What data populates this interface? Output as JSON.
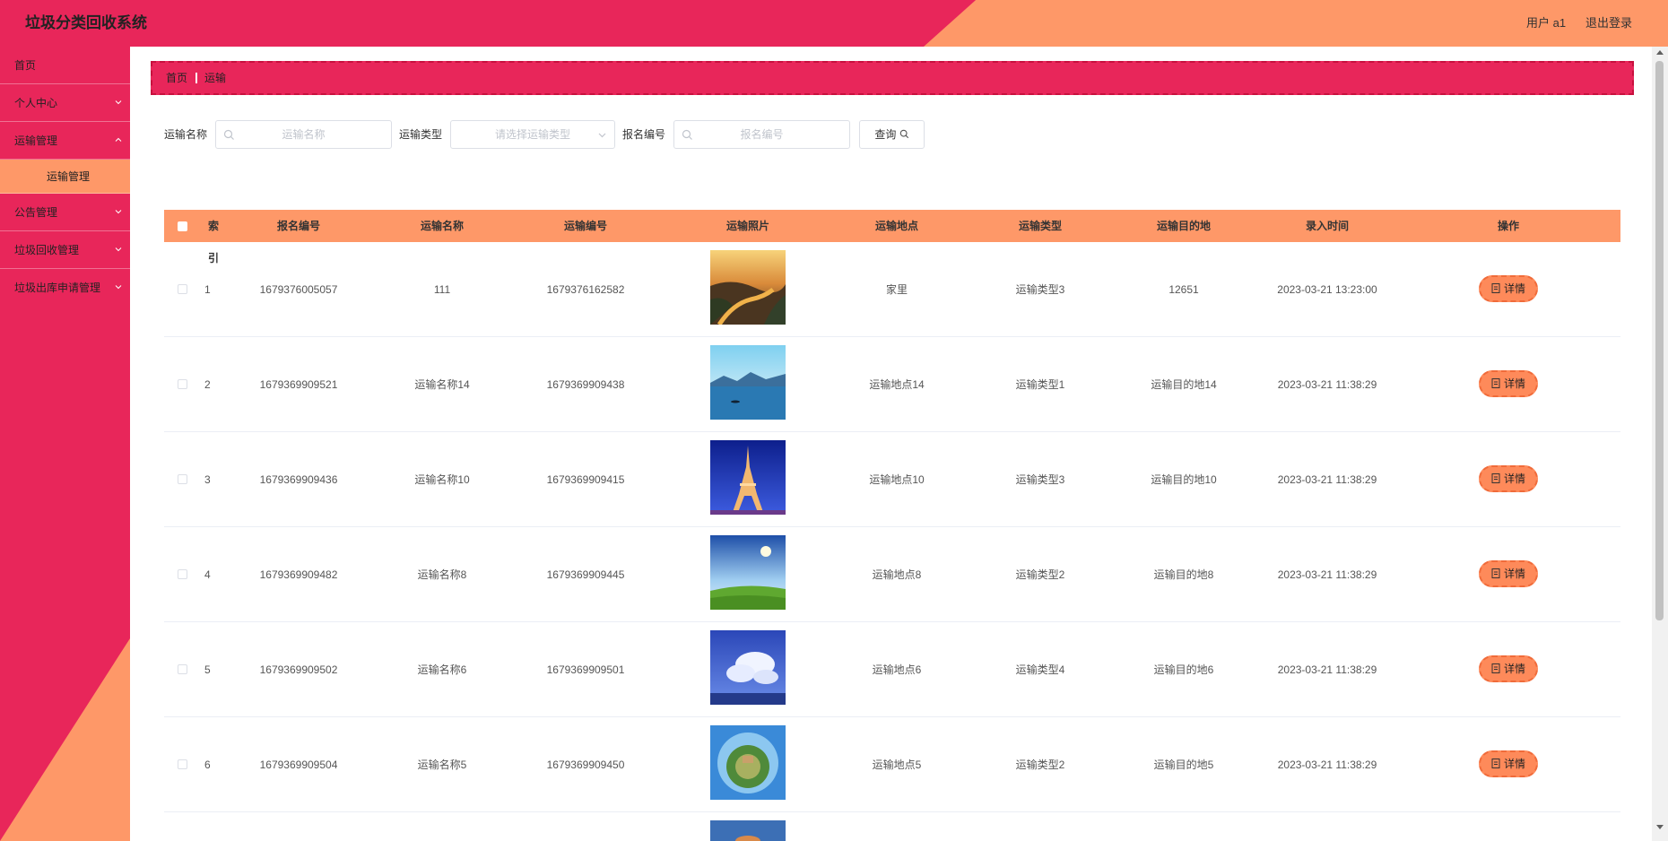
{
  "header": {
    "title": "垃圾分类回收系统",
    "user": "用户 a1",
    "logout": "退出登录"
  },
  "sidebar": {
    "items": [
      {
        "label": "首页"
      },
      {
        "label": "个人中心"
      },
      {
        "label": "运输管理"
      },
      {
        "label": "运输管理"
      },
      {
        "label": "公告管理"
      },
      {
        "label": "垃圾回收管理"
      },
      {
        "label": "垃圾出库申请管理"
      }
    ]
  },
  "breadcrumb": {
    "home": "首页",
    "current": "运输"
  },
  "search": {
    "name_label": "运输名称",
    "name_placeholder": "运输名称",
    "type_label": "运输类型",
    "type_placeholder": "请选择运输类型",
    "regno_label": "报名编号",
    "regno_placeholder": "报名编号",
    "query_button": "查询"
  },
  "table": {
    "headers": [
      "索引",
      "报名编号",
      "运输名称",
      "运输编号",
      "运输照片",
      "运输地点",
      "运输类型",
      "运输目的地",
      "录入时间",
      "操作"
    ],
    "detail_label": "详情",
    "rows": [
      {
        "index": "1",
        "regno": "1679376005057",
        "name": "111",
        "transport_no": "1679376162582",
        "place": "家里",
        "type": "运输类型3",
        "dest": "12651",
        "time": "2023-03-21 13:23:00",
        "photo": "river-valley"
      },
      {
        "index": "2",
        "regno": "1679369909521",
        "name": "运输名称14",
        "transport_no": "1679369909438",
        "place": "运输地点14",
        "type": "运输类型1",
        "dest": "运输目的地14",
        "time": "2023-03-21 11:38:29",
        "photo": "lake-mountains"
      },
      {
        "index": "3",
        "regno": "1679369909436",
        "name": "运输名称10",
        "transport_no": "1679369909415",
        "place": "运输地点10",
        "type": "运输类型3",
        "dest": "运输目的地10",
        "time": "2023-03-21 11:38:29",
        "photo": "eiffel-tower"
      },
      {
        "index": "4",
        "regno": "1679369909482",
        "name": "运输名称8",
        "transport_no": "1679369909445",
        "place": "运输地点8",
        "type": "运输类型2",
        "dest": "运输目的地8",
        "time": "2023-03-21 11:38:29",
        "photo": "grass-sky"
      },
      {
        "index": "5",
        "regno": "1679369909502",
        "name": "运输名称6",
        "transport_no": "1679369909501",
        "place": "运输地点6",
        "type": "运输类型4",
        "dest": "运输目的地6",
        "time": "2023-03-21 11:38:29",
        "photo": "cloudy-sky"
      },
      {
        "index": "6",
        "regno": "1679369909504",
        "name": "运输名称5",
        "transport_no": "1679369909450",
        "place": "运输地点5",
        "type": "运输类型2",
        "dest": "运输目的地5",
        "time": "2023-03-21 11:38:29",
        "photo": "tiny-planet"
      }
    ]
  },
  "colors": {
    "primary": "#e8265a",
    "accent": "#fe9868"
  }
}
